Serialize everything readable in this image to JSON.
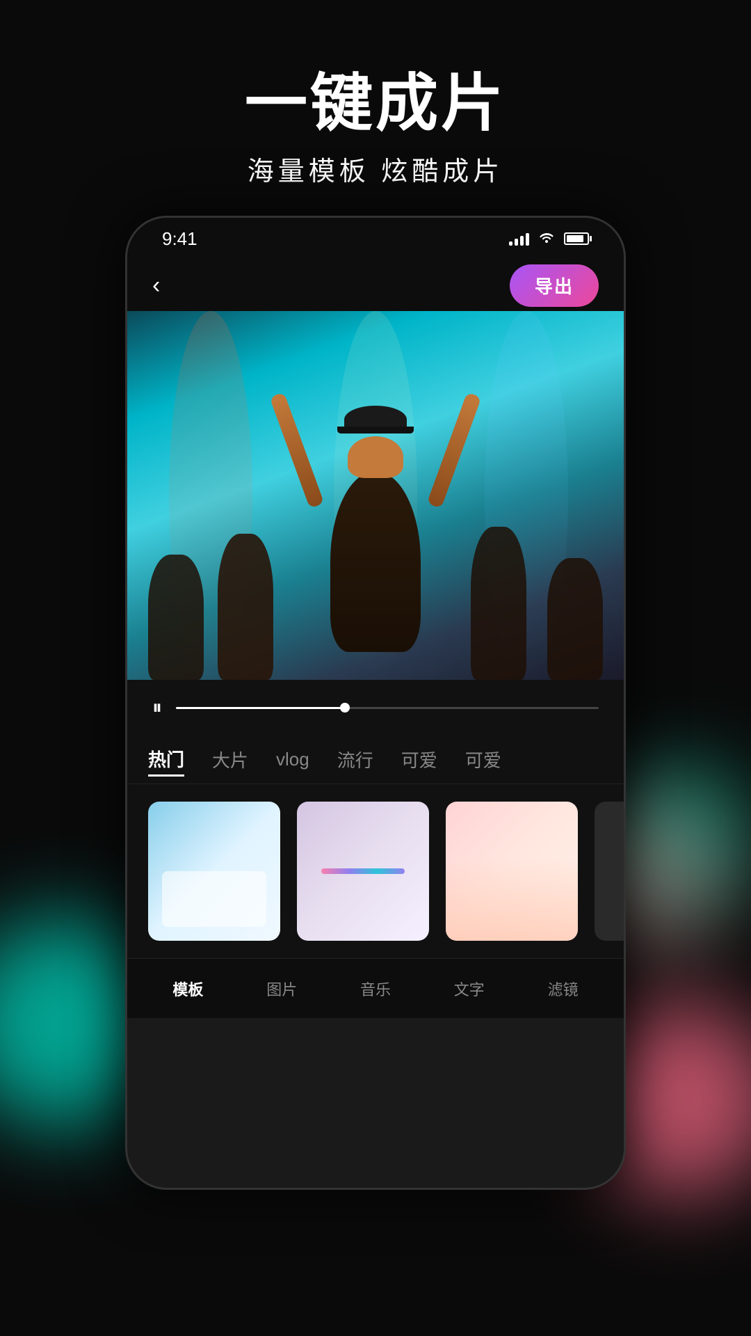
{
  "app": {
    "background_color": "#0a0a0a"
  },
  "header": {
    "title": "一键成片",
    "subtitle": "海量模板  炫酷成片"
  },
  "phone": {
    "status_bar": {
      "time": "9:41",
      "signal_label": "signal",
      "wifi_label": "wifi",
      "battery_label": "battery"
    },
    "top_nav": {
      "back_label": "‹",
      "export_label": "导出"
    },
    "timeline": {
      "play_pause_icon": "⏸",
      "progress_percent": 40
    },
    "category_tabs": [
      {
        "id": "hot",
        "label": "热门",
        "active": true
      },
      {
        "id": "big",
        "label": "大片",
        "active": false
      },
      {
        "id": "vlog",
        "label": "vlog",
        "active": false
      },
      {
        "id": "popular",
        "label": "流行",
        "active": false
      },
      {
        "id": "cute1",
        "label": "可爱",
        "active": false
      },
      {
        "id": "cute2",
        "label": "可爱",
        "active": false
      }
    ],
    "bottom_nav": [
      {
        "id": "template",
        "label": "模板",
        "active": true
      },
      {
        "id": "photo",
        "label": "图片",
        "active": false
      },
      {
        "id": "music",
        "label": "音乐",
        "active": false
      },
      {
        "id": "text",
        "label": "文字",
        "active": false
      },
      {
        "id": "filter",
        "label": "滤镜",
        "active": false
      }
    ]
  },
  "icons": {
    "back": "‹",
    "pause": "⏸",
    "signal": "▂▄▆█",
    "wifi": "⊙",
    "battery": "▓"
  }
}
